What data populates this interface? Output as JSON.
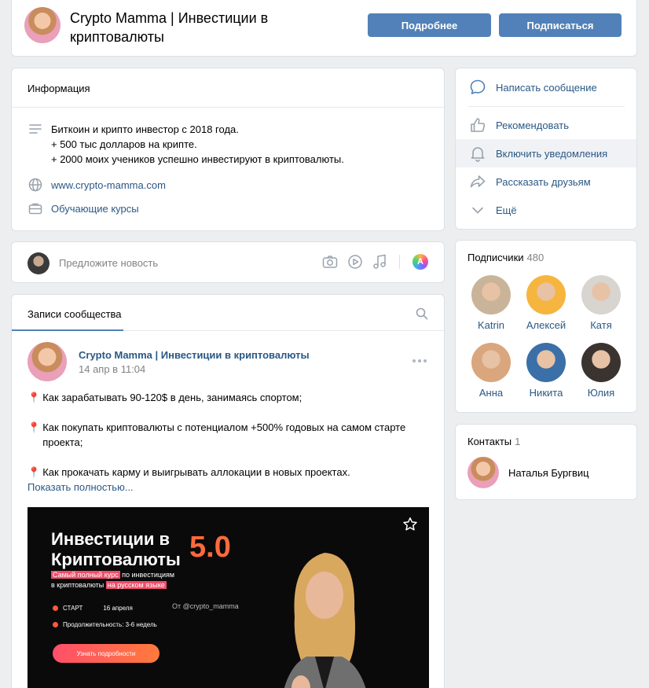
{
  "header": {
    "title": "Crypto Mamma | Инвестиции в криптовалюты",
    "btn_more": "Подробнее",
    "btn_subscribe": "Подписаться"
  },
  "info": {
    "heading": "Информация",
    "description": [
      "Биткоин и крипто инвестор с 2018 года.",
      "+ 500 тыс долларов на крипте.",
      "+ 2000 моих учеников успешно инвестируют в криптовалюты."
    ],
    "website": "www.crypto-mamma.com",
    "courses": "Обучающие курсы"
  },
  "suggest": {
    "placeholder": "Предложите новость",
    "ai_glyph": "A"
  },
  "posts": {
    "tab": "Записи сообщества",
    "post": {
      "author": "Crypto Mamma | Инвестиции в криптовалюты",
      "date": "14 апр в 11:04",
      "lines": [
        "Как зарабатывать 90-120$ в день, занимаясь спортом;",
        "Как покупать криптовалюты с потенциалом +500% годовых на самом старте проекта;",
        "Как прокачать карму и выигрывать аллокации в новых проектах."
      ],
      "show_more": "Показать полностью...",
      "banner": {
        "title_line1": "Инвестиции в",
        "title_line2": "Криптовалюты",
        "version": "5.0",
        "sub_hl1": "Самый полный курс",
        "sub_rest1": " по инвестициям",
        "sub_rest2": "в криптовалюты ",
        "sub_hl2": "на русском языке",
        "handle": "От @crypto_mamma",
        "start_label": "СТАРТ",
        "start_date": "16 апреля",
        "duration": "Продолжительность: 3-6 недель",
        "cta": "Узнать подробности"
      }
    }
  },
  "actions": {
    "write": "Написать сообщение",
    "recommend": "Рекомендовать",
    "notify": "Включить уведомления",
    "share": "Рассказать друзьям",
    "more": "Ещё"
  },
  "subscribers": {
    "title": "Подписчики",
    "count": "480",
    "items": [
      {
        "name": "Katrin",
        "color": "#c9b49a"
      },
      {
        "name": "Алексей",
        "color": "#f5b53f"
      },
      {
        "name": "Катя",
        "color": "#d8d4cf"
      },
      {
        "name": "Анна",
        "color": "#d9a67e"
      },
      {
        "name": "Никита",
        "color": "#3b6fa8"
      },
      {
        "name": "Юлия",
        "color": "#3a3330"
      }
    ]
  },
  "contacts": {
    "title": "Контакты",
    "count": "1",
    "name": "Наталья Бургвиц"
  }
}
